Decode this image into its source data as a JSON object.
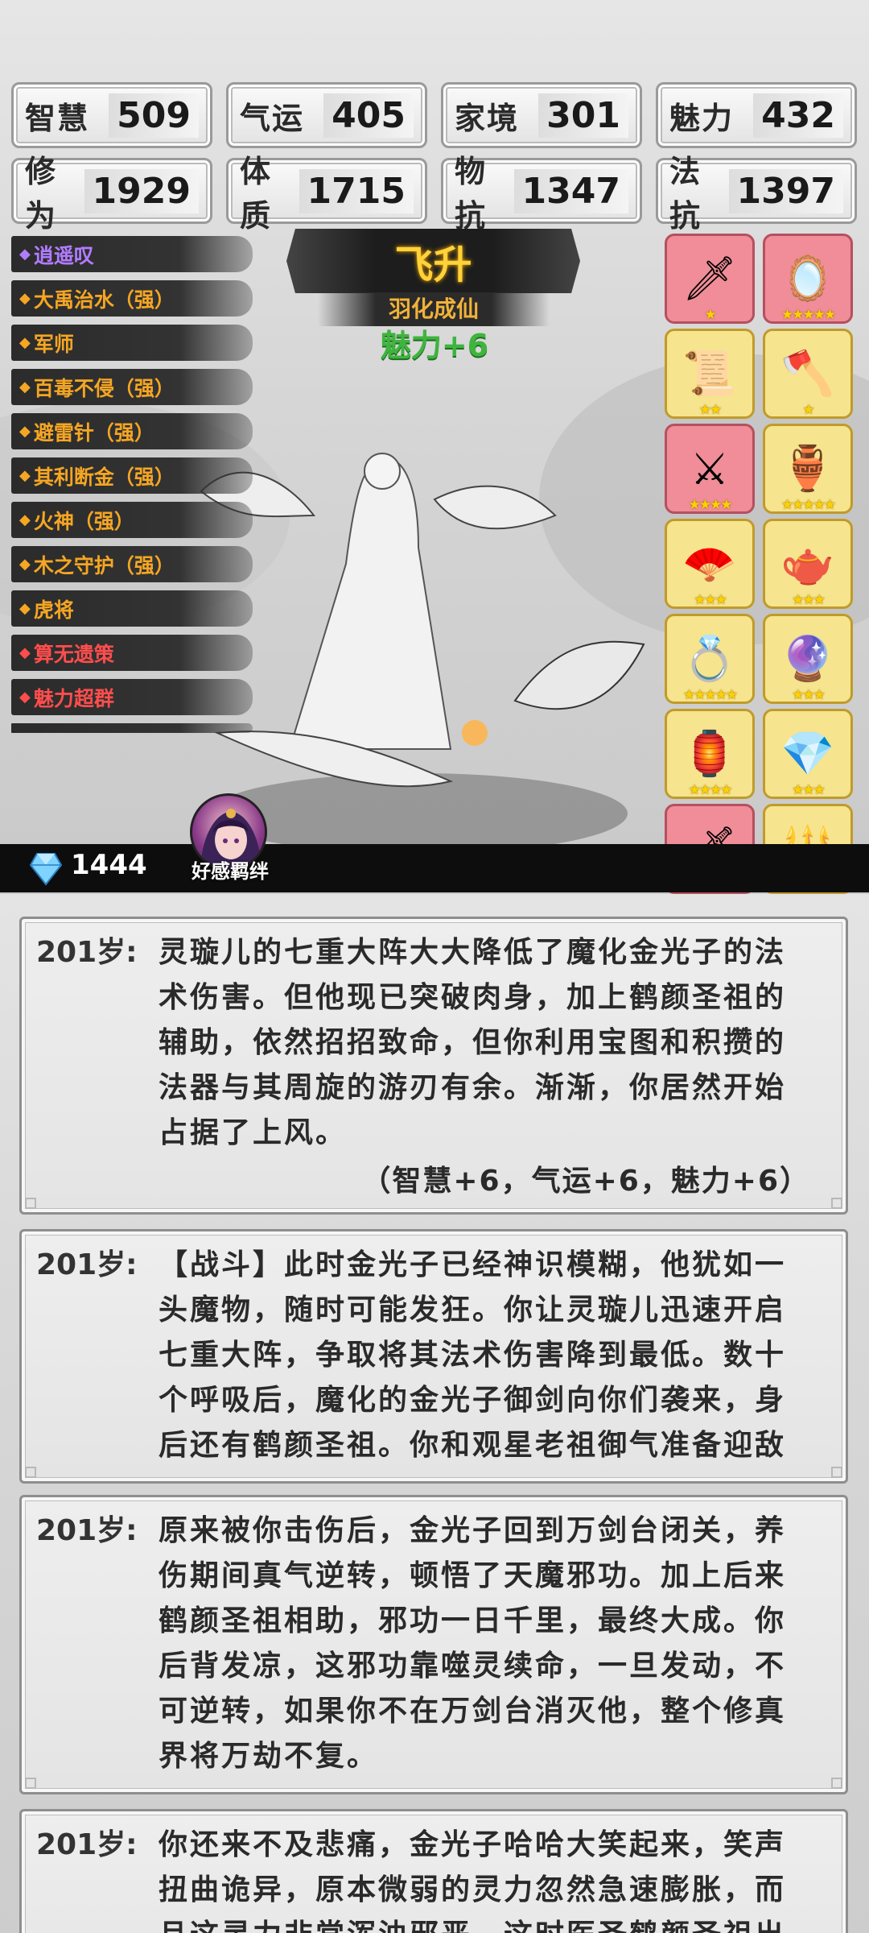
{
  "stats": [
    {
      "label": "智慧",
      "value": "509"
    },
    {
      "label": "气运",
      "value": "405"
    },
    {
      "label": "家境",
      "value": "301"
    },
    {
      "label": "魅力",
      "value": "432"
    },
    {
      "label": "修为",
      "value": "1929"
    },
    {
      "label": "体质",
      "value": "1715"
    },
    {
      "label": "物抗",
      "value": "1347"
    },
    {
      "label": "法抗",
      "value": "1397"
    }
  ],
  "traits": [
    {
      "label": "逍遥叹",
      "color": "#b27cff"
    },
    {
      "label": "大禹治水（强）",
      "color": "#f5a623"
    },
    {
      "label": "军师",
      "color": "#f5a623"
    },
    {
      "label": "百毒不侵（强）",
      "color": "#f5a623"
    },
    {
      "label": "避雷针（强）",
      "color": "#f5a623"
    },
    {
      "label": "其利断金（强）",
      "color": "#f5a623"
    },
    {
      "label": "火神（强）",
      "color": "#f5a623"
    },
    {
      "label": "木之守护（强）",
      "color": "#f5a623"
    },
    {
      "label": "虎将",
      "color": "#f5a623"
    },
    {
      "label": "算无遗策",
      "color": "#ff4d4d"
    },
    {
      "label": "魅力超群",
      "color": "#ff4d4d"
    }
  ],
  "event": {
    "title": "飞升",
    "subtitle": "羽化成仙",
    "bonus": "魅力+6"
  },
  "items": [
    {
      "icon": "spear-icon",
      "glyph": "🗡",
      "rarity": "pink",
      "stars": "★"
    },
    {
      "icon": "mirror-icon",
      "glyph": "🪞",
      "rarity": "pink",
      "stars": "★★★★★"
    },
    {
      "icon": "scroll-icon",
      "glyph": "📜",
      "rarity": "yellow",
      "stars": "★★"
    },
    {
      "icon": "axe-icon",
      "glyph": "🪓",
      "rarity": "yellow",
      "stars": "★"
    },
    {
      "icon": "halberd-icon",
      "glyph": "⚔",
      "rarity": "pink",
      "stars": "★★★★"
    },
    {
      "icon": "incense-burner-icon",
      "glyph": "🏺",
      "rarity": "yellow",
      "stars": "★★★★★"
    },
    {
      "icon": "fan-icon",
      "glyph": "🪭",
      "rarity": "yellow",
      "stars": "★★★"
    },
    {
      "icon": "teapot-icon",
      "glyph": "🫖",
      "rarity": "yellow",
      "stars": "★★★"
    },
    {
      "icon": "ring-icon",
      "glyph": "💍",
      "rarity": "yellow",
      "stars": "★★★★★"
    },
    {
      "icon": "orb-icon",
      "glyph": "🔮",
      "rarity": "yellow",
      "stars": "★★★"
    },
    {
      "icon": "cauldron-icon",
      "glyph": "🏮",
      "rarity": "yellow",
      "stars": "★★★★"
    },
    {
      "icon": "crystal-icon",
      "glyph": "💎",
      "rarity": "yellow",
      "stars": "★★★"
    },
    {
      "icon": "sword-icon",
      "glyph": "🗡",
      "rarity": "pink",
      "stars": "★★★★"
    },
    {
      "icon": "dagger-icon",
      "glyph": "🔱",
      "rarity": "yellow",
      "stars": "★★"
    }
  ],
  "bottom_bar": {
    "gem_count": "1444",
    "affection_label": "好感羁绊"
  },
  "log": [
    {
      "age": "201岁:",
      "text": "灵璇儿的七重大阵大大降低了魔化金光子的法术伤害。但他现已突破肉身，加上鹤颜圣祖的辅助，依然招招致命，但你利用宝图和积攒的法器与其周旋的游刃有余。渐渐，你居然开始占据了上风。",
      "gain": "（智慧+6，气运+6，魅力+6）"
    },
    {
      "age": "201岁:",
      "text": "【战斗】此时金光子已经神识模糊，他犹如一头魔物，随时可能发狂。你让灵璇儿迅速开启七重大阵，争取将其法术伤害降到最低。数十个呼吸后，魔化的金光子御剑向你们袭来，身后还有鹤颜圣祖。你和观星老祖御气准备迎敌",
      "gain": ""
    },
    {
      "age": "201岁:",
      "text": "原来被你击伤后，金光子回到万剑台闭关，养伤期间真气逆转，顿悟了天魔邪功。加上后来鹤颜圣祖相助，邪功一日千里，最终大成。你后背发凉，这邪功靠噬灵续命，一旦发动，不可逆转，如果你不在万剑台消灭他，整个修真界将万劫不复。",
      "gain": ""
    },
    {
      "age": "201岁:",
      "text": "你还来不及悲痛，金光子哈哈大笑起来，笑声扭曲诡异，原本微弱的灵力忽然急速膨胀，而且这灵力非常浑浊邪恶，这时医圣鹤颜圣祖出现在了",
      "gain": ""
    }
  ]
}
